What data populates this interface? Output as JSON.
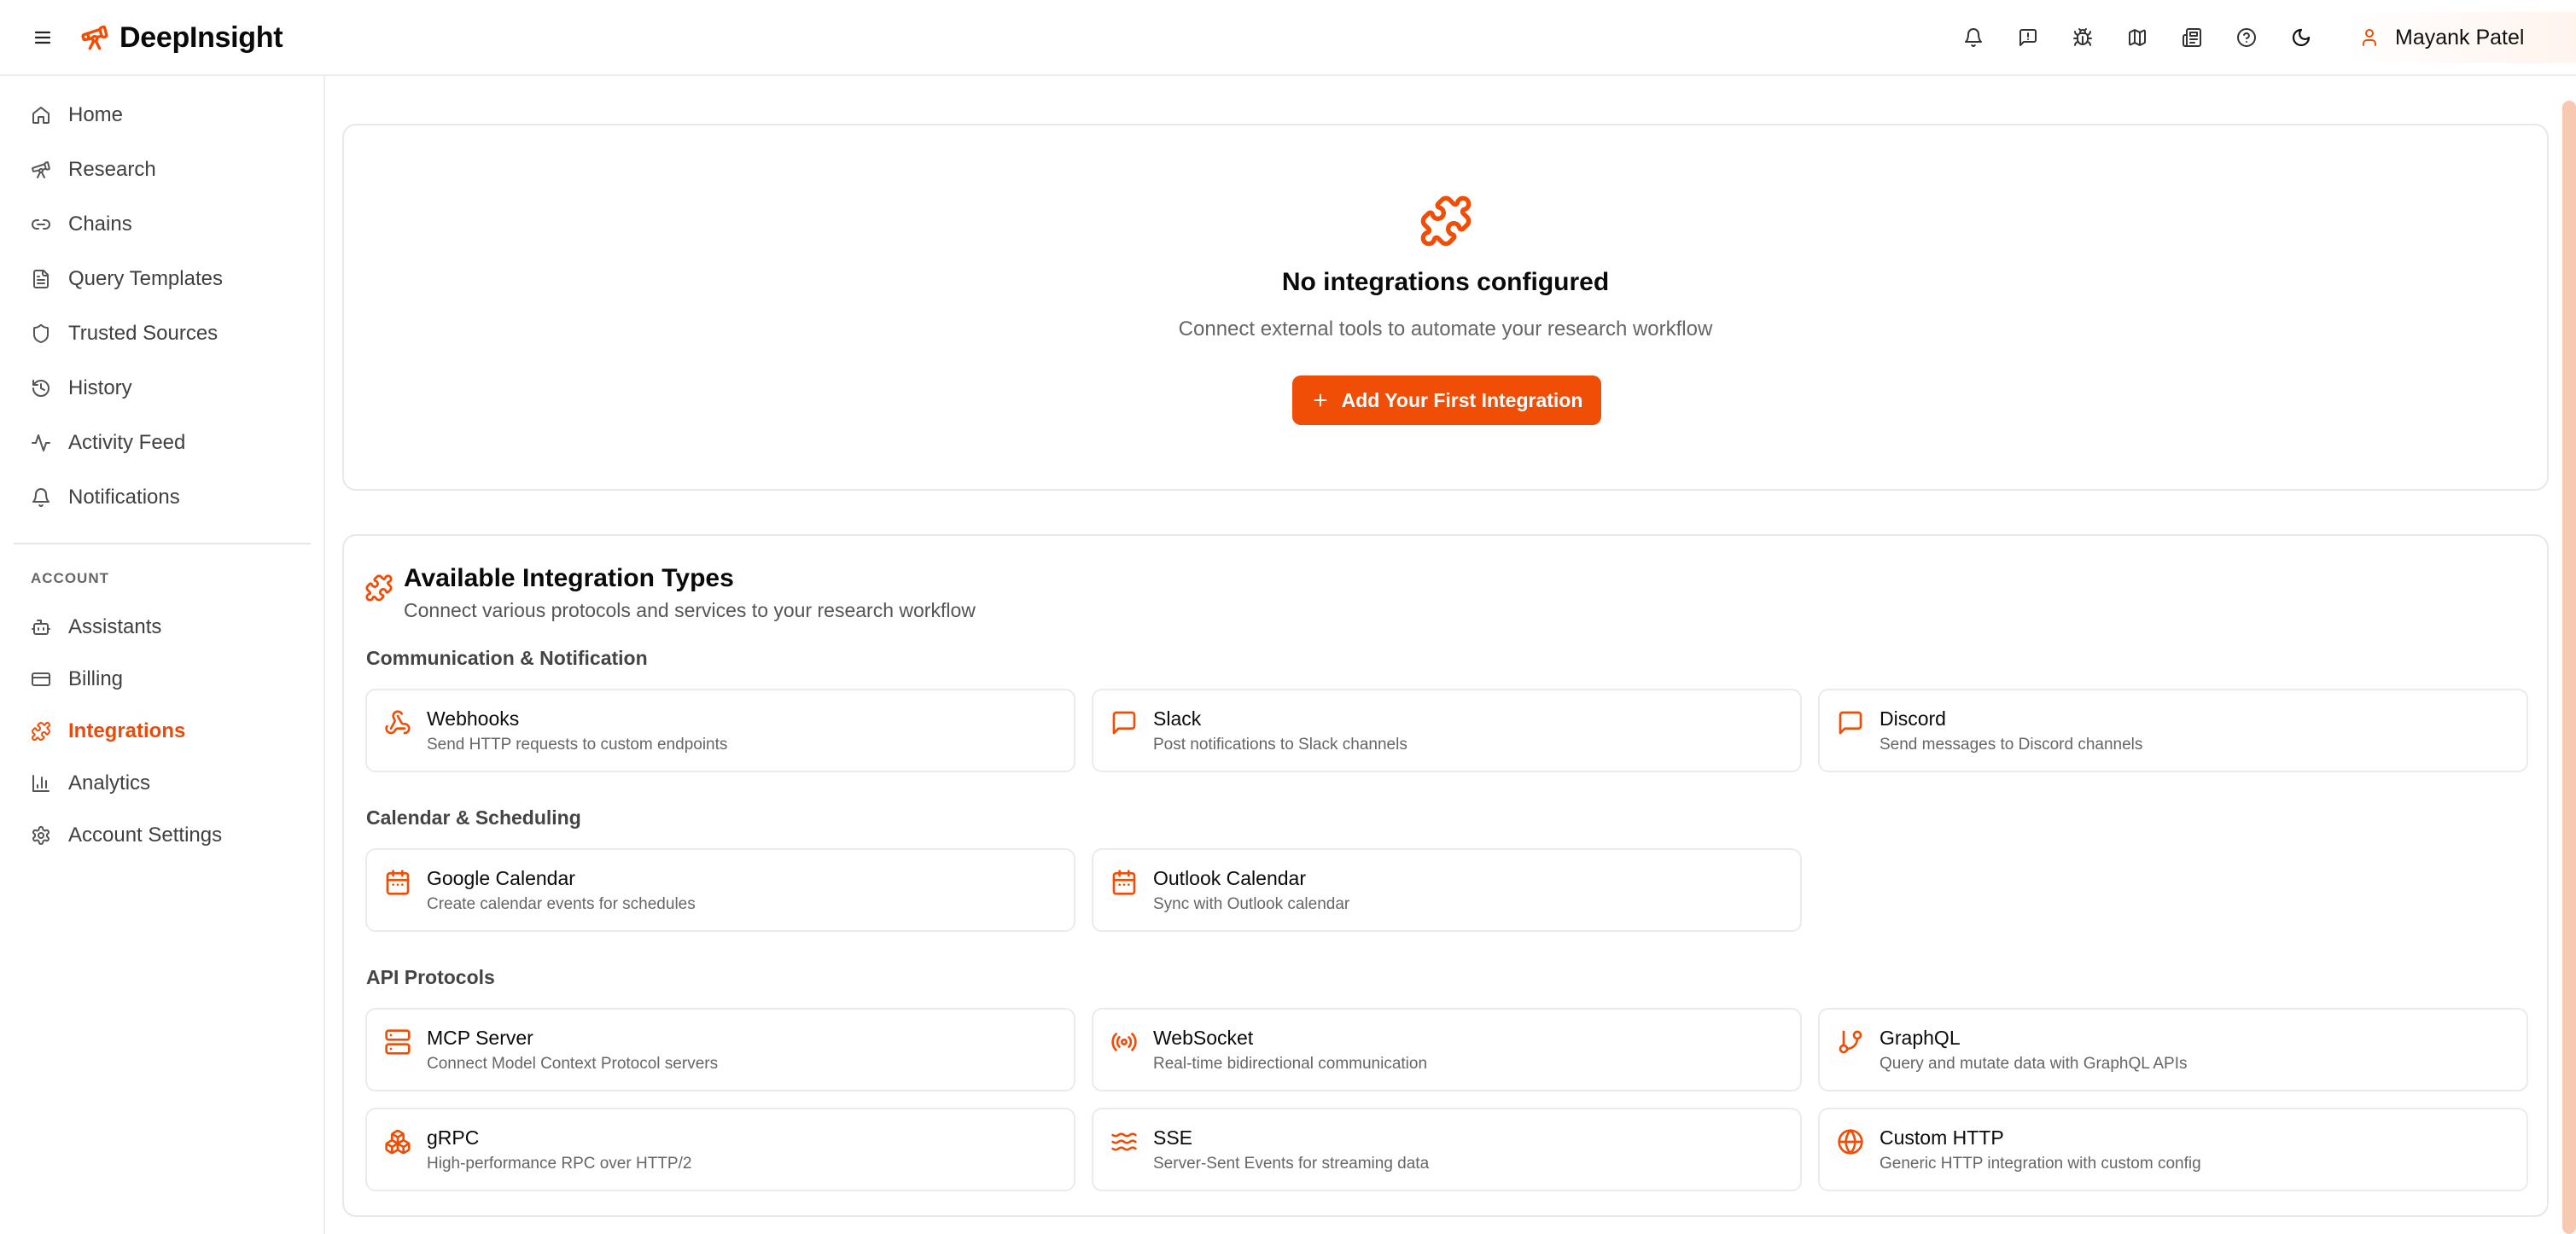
{
  "colors": {
    "accent": "#f04d07",
    "accent_text": "#ea4a0a"
  },
  "app": {
    "name": "DeepInsight"
  },
  "user": {
    "name": "Mayank Patel"
  },
  "header_icons": [
    "bell-icon",
    "message-icon",
    "bug-icon",
    "map-icon",
    "newspaper-icon",
    "help-icon",
    "moon-icon"
  ],
  "sidebar": {
    "main_items": [
      {
        "label": "Home",
        "icon": "home-icon"
      },
      {
        "label": "Research",
        "icon": "telescope-icon"
      },
      {
        "label": "Chains",
        "icon": "link-icon"
      },
      {
        "label": "Query Templates",
        "icon": "file-text-icon"
      },
      {
        "label": "Trusted Sources",
        "icon": "shield-icon"
      },
      {
        "label": "History",
        "icon": "history-icon"
      },
      {
        "label": "Activity Feed",
        "icon": "activity-icon"
      },
      {
        "label": "Notifications",
        "icon": "bell-icon"
      }
    ],
    "section_label": "ACCOUNT",
    "account_items": [
      {
        "label": "Assistants",
        "icon": "assistant-icon"
      },
      {
        "label": "Billing",
        "icon": "credit-card-icon"
      },
      {
        "label": "Integrations",
        "icon": "puzzle-icon",
        "active": true
      },
      {
        "label": "Analytics",
        "icon": "bar-chart-icon"
      },
      {
        "label": "Account Settings",
        "icon": "gear-icon"
      }
    ]
  },
  "empty_state": {
    "title": "No integrations configured",
    "subtitle": "Connect external tools to automate your research workflow",
    "button_label": "Add Your First Integration"
  },
  "types": {
    "title": "Available Integration Types",
    "subtitle": "Connect various protocols and services to your research workflow",
    "categories": [
      {
        "title": "Communication & Notification",
        "items": [
          {
            "name": "Webhooks",
            "desc": "Send HTTP requests to custom endpoints",
            "icon": "webhook-icon"
          },
          {
            "name": "Slack",
            "desc": "Post notifications to Slack channels",
            "icon": "message-square-icon"
          },
          {
            "name": "Discord",
            "desc": "Send messages to Discord channels",
            "icon": "message-square-icon"
          }
        ]
      },
      {
        "title": "Calendar & Scheduling",
        "items": [
          {
            "name": "Google Calendar",
            "desc": "Create calendar events for schedules",
            "icon": "calendar-icon"
          },
          {
            "name": "Outlook Calendar",
            "desc": "Sync with Outlook calendar",
            "icon": "calendar-icon"
          }
        ]
      },
      {
        "title": "API Protocols",
        "items": [
          {
            "name": "MCP Server",
            "desc": "Connect Model Context Protocol servers",
            "icon": "server-icon"
          },
          {
            "name": "WebSocket",
            "desc": "Real-time bidirectional communication",
            "icon": "radio-icon"
          },
          {
            "name": "GraphQL",
            "desc": "Query and mutate data with GraphQL APIs",
            "icon": "git-branch-icon"
          },
          {
            "name": "gRPC",
            "desc": "High-performance RPC over HTTP/2",
            "icon": "boxes-icon"
          },
          {
            "name": "SSE",
            "desc": "Server-Sent Events for streaming data",
            "icon": "waves-icon"
          },
          {
            "name": "Custom HTTP",
            "desc": "Generic HTTP integration with custom config",
            "icon": "globe-icon"
          }
        ]
      }
    ]
  }
}
